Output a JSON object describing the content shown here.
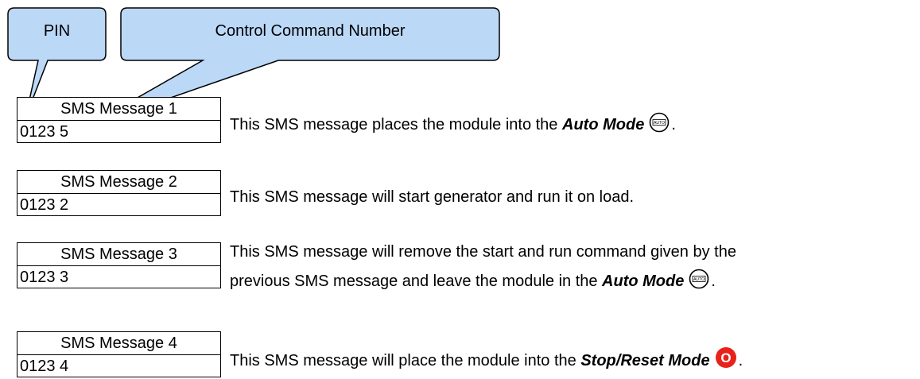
{
  "callouts": {
    "pin_label": "PIN",
    "command_label": "Control Command Number"
  },
  "messages": [
    {
      "title": "SMS Message 1",
      "value": "0123 5",
      "description_prefix": "This SMS message places the module into the ",
      "mode": "Auto Mode",
      "icon": "auto-mode-icon",
      "suffix": "."
    },
    {
      "title": "SMS Message 2",
      "value": "0123 2",
      "description": "This SMS message will start generator and run it on load."
    },
    {
      "title": "SMS Message 3",
      "value": "0123 3",
      "description_line1": "This SMS message will remove the start and run command given by the",
      "description_line2_prefix": "previous SMS message and leave the module in the ",
      "mode": "Auto Mode",
      "icon": "auto-mode-icon",
      "suffix": "."
    },
    {
      "title": "SMS Message 4",
      "value": "0123 4",
      "description_prefix": "This SMS message will place the module into the ",
      "mode": "Stop/Reset Mode",
      "icon": "stop-reset-icon",
      "suffix": "."
    }
  ],
  "icons": {
    "auto_text": "AUTO",
    "stop_text": "O"
  },
  "colors": {
    "callout_fill": "#bcd8f7",
    "callout_stroke": "#000000",
    "stop_red": "#e8221b"
  }
}
